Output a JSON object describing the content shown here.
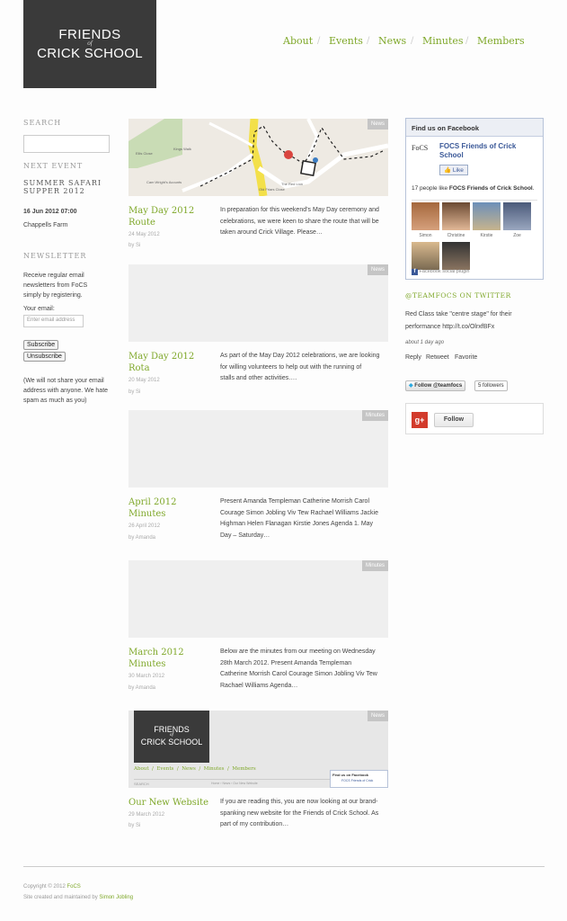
{
  "site": {
    "logo_line1": "FRIENDS",
    "logo_of": "of",
    "logo_line2": "CRICK SCHOOL"
  },
  "nav": {
    "items": [
      "About",
      "Events",
      "News",
      "Minutes",
      "Members"
    ],
    "separator": "/"
  },
  "sidebar": {
    "search_heading": "SEARCH",
    "next_event_heading": "NEXT EVENT",
    "event_title_line1": "SUMMER SAFARI",
    "event_title_line2": "SUPPER 2012",
    "event_date": "16 Jun 2012 07:00",
    "event_location": "Chappells Farm",
    "newsletter_heading": "NEWSLETTER",
    "newsletter_text": [
      "Receive regular email",
      "newsletters from FoCS",
      "simply by registering."
    ],
    "email_label": "Your email:",
    "email_placeholder": "Enter email address",
    "subscribe_label": "Subscribe",
    "unsubscribe_label": "Unsubscribe",
    "privacy_text": [
      "(We will not share your email",
      "address with anyone. We hate",
      "spam as much as you)"
    ]
  },
  "posts": [
    {
      "tag": "News",
      "title_lines": [
        "May Day 2012",
        "Route"
      ],
      "date": "24 May 2012",
      "author": "by  Si",
      "excerpt": [
        "In preparation for this weekend’s May Day ceremony and",
        "celebrations, we were keen to share the route that will be",
        "taken around Crick Village. Please…"
      ]
    },
    {
      "tag": "News",
      "title_lines": [
        "May Day 2012",
        "Rota"
      ],
      "date": "20 May 2012",
      "author": "by  Si",
      "excerpt": [
        "As part of the May Day 2012 celebrations, we are looking",
        "for willing volunteers to help out with the running of",
        "stalls and other activities…."
      ]
    },
    {
      "tag": "Minutes",
      "title_lines": [
        "April 2012",
        "Minutes"
      ],
      "date": "26 April 2012",
      "author": "by  Amanda",
      "excerpt": [
        "Present Amanda Templeman Catherine Morrish Carol",
        "Courage Simon Jobling Viv Tew Rachael Williams Jackie",
        "Highman Helen Flanagan Kirstie Jones Agenda 1. May",
        "Day – Saturday…"
      ]
    },
    {
      "tag": "Minutes",
      "title_lines": [
        "March 2012",
        "Minutes"
      ],
      "date": "30 March 2012",
      "author": "by  Amanda",
      "excerpt": [
        "Below are the minutes from our meeting on Wednesday",
        "28th March 2012. Present Amanda Templeman",
        "Catherine Morrish Carol Courage Simon Jobling Viv Tew",
        "Rachael Williams  Agenda…"
      ]
    },
    {
      "tag": "News",
      "title_lines": [
        "Our New Website"
      ],
      "date": "29 March 2012",
      "author": "by  Si",
      "excerpt": [
        "If you are reading this, you are now looking at our brand-",
        "spanking new website for the Friends of Crick School. As",
        "part of my contribution…"
      ]
    }
  ],
  "map_labels": {
    "a": "Kings Walk",
    "b": "Ellis Close",
    "c": "Cam Wright's Acounts",
    "d": "Old Friars Close",
    "e": "The Red Lion"
  },
  "screenshot_thumb": {
    "logo_line1": "FRIENDS",
    "logo_of": "of",
    "logo_line2": "CRICK SCHOOL",
    "nav": [
      "About",
      "Events",
      "News",
      "Minutes",
      "Members"
    ],
    "search": "SEARCH",
    "crumb": "Home  ›  News  ›  Our New Website",
    "fb_header": "Find us on Facebook",
    "fb_name": "FOCS Friends of Crick"
  },
  "facebook": {
    "header": "Find us on Facebook",
    "logo_text": "FoCS",
    "page_name": "FOCS Friends of Crick School",
    "like_label": "Like",
    "count_prefix": "17 people like ",
    "count_bold": "FOCS Friends of Crick School",
    "count_suffix": ".",
    "fans": [
      "Simon",
      "Christine",
      "Kirstie",
      "Zoe"
    ],
    "plugin_label": "Facebook social plugin"
  },
  "twitter": {
    "heading": "@TEAMFOCS ON TWITTER",
    "tweet_line1": "Red Class take \"centre stage\" for their",
    "tweet_line2": "performance http://t.co/OlrxfBFx",
    "time": "about 1 day ago",
    "reply": "Reply",
    "retweet": "Retweet",
    "favorite": "Favorite",
    "follow_label": "Follow @teamfocs",
    "followers": "5 followers"
  },
  "gplus": {
    "follow_label": "Follow"
  },
  "footer": {
    "copyright_prefix": "Copyright © 2012 ",
    "copyright_link": "FoCS",
    "credit_prefix": "Site created and maintained by ",
    "credit_link": "Simon Jobling"
  },
  "colors": {
    "accent": "#7fa82a",
    "logo_bg": "#3a3a3a",
    "facebook_blue": "#3b5998"
  }
}
